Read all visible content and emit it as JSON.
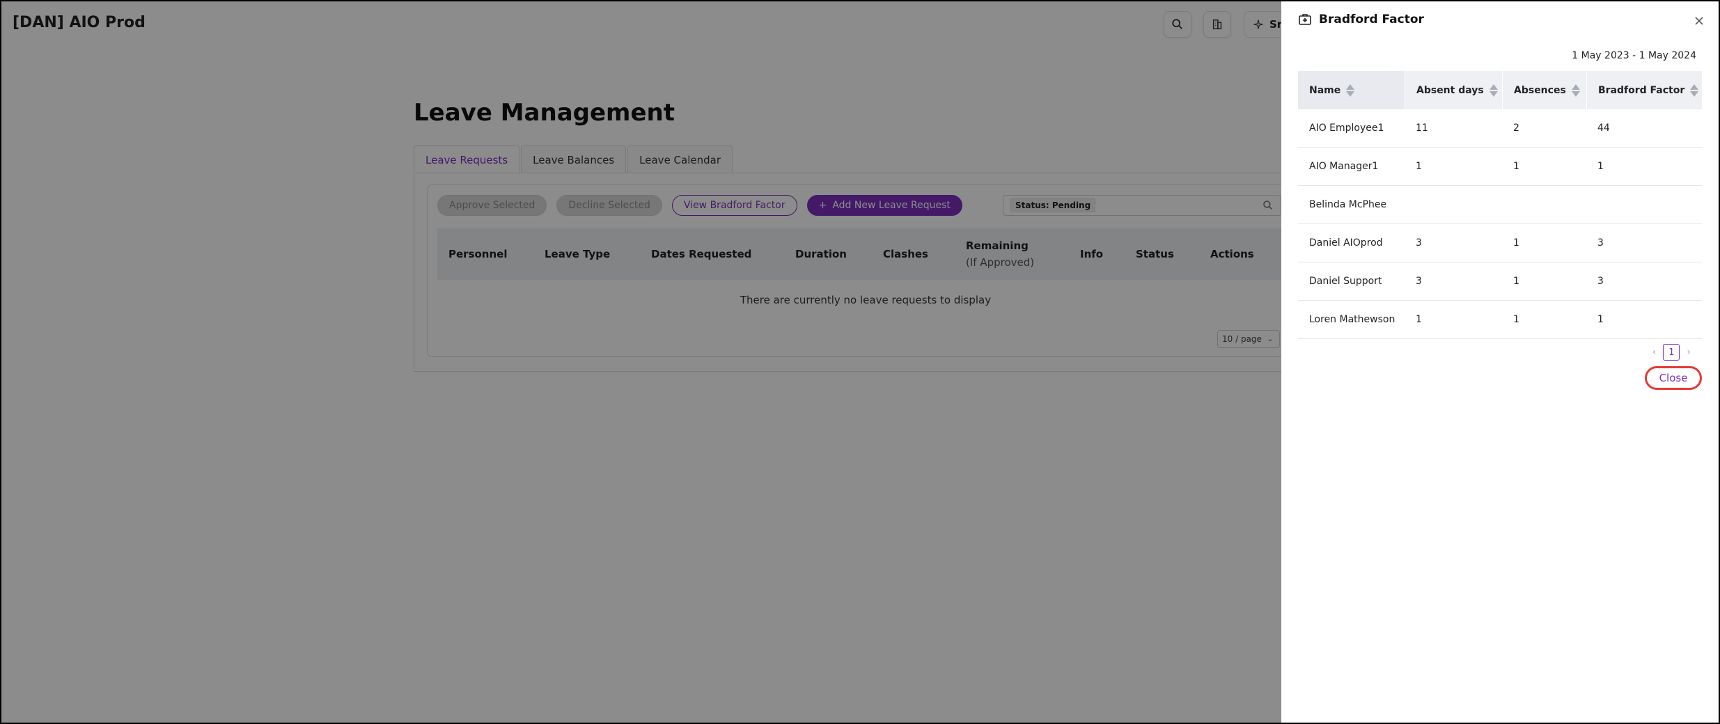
{
  "app": {
    "title": "[DAN] AIO Prod",
    "top_wide_label": "Sm"
  },
  "page": {
    "title": "Leave Management"
  },
  "tabs": [
    {
      "label": "Leave Requests",
      "active": true
    },
    {
      "label": "Leave Balances",
      "active": false
    },
    {
      "label": "Leave Calendar",
      "active": false
    }
  ],
  "actions": {
    "approve": "Approve Selected",
    "decline": "Decline Selected",
    "bradford": "View Bradford Factor",
    "add": "Add New Leave Request"
  },
  "search": {
    "tag": "Status: Pending"
  },
  "requests_table": {
    "columns": [
      "Personnel",
      "Leave Type",
      "Dates Requested",
      "Duration",
      "Clashes",
      "Remaining",
      "(If Approved)",
      "Info",
      "Status",
      "Actions"
    ],
    "empty_text": "There are currently no leave requests to display",
    "page_size": "10 / page"
  },
  "drawer": {
    "title": "Bradford Factor",
    "date_range": "1 May 2023 - 1 May 2024",
    "columns": [
      "Name",
      "Absent days",
      "Absences",
      "Bradford Factor"
    ],
    "rows": [
      [
        "AIO Employee1",
        "11",
        "2",
        "44"
      ],
      [
        "AIO Manager1",
        "1",
        "1",
        "1"
      ],
      [
        "Belinda McPhee",
        "",
        "",
        ""
      ],
      [
        "Daniel AIOprod",
        "3",
        "1",
        "3"
      ],
      [
        "Daniel Support",
        "3",
        "1",
        "3"
      ],
      [
        "Loren Mathewson",
        "1",
        "1",
        "1"
      ]
    ],
    "page": "1",
    "close_label": "Close"
  },
  "colors": {
    "accent": "#7b2fbe",
    "highlight": "#e53935"
  }
}
